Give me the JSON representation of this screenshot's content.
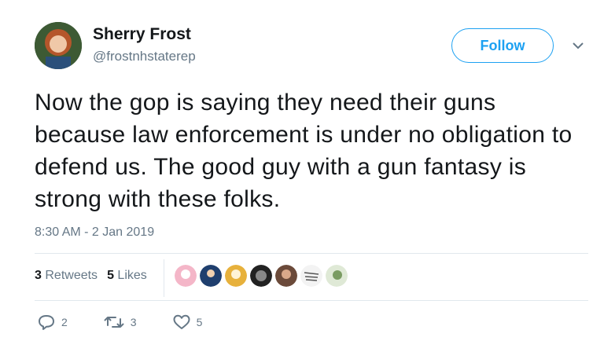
{
  "author": {
    "name": "Sherry Frost",
    "handle": "@frostnhstaterep"
  },
  "follow_button": "Follow",
  "tweet_text": "Now the gop is saying they need their guns because law enforcement is under no obligation to defend us.  The good guy with a gun fantasy is strong with these folks.",
  "timestamp": "8:30 AM - 2 Jan 2019",
  "stats": {
    "retweets_count": "3",
    "retweets_label": "Retweets",
    "likes_count": "5",
    "likes_label": "Likes"
  },
  "liker_avatars": [
    "avatar-pink",
    "avatar-blue",
    "avatar-yellow",
    "avatar-dark",
    "avatar-brown",
    "avatar-scribble",
    "avatar-green"
  ],
  "actions": {
    "replies": "2",
    "retweets": "3",
    "likes": "5"
  },
  "colors": {
    "accent": "#1da1f2",
    "text": "#14171a",
    "muted": "#657786",
    "divider": "#e1e8ed"
  }
}
